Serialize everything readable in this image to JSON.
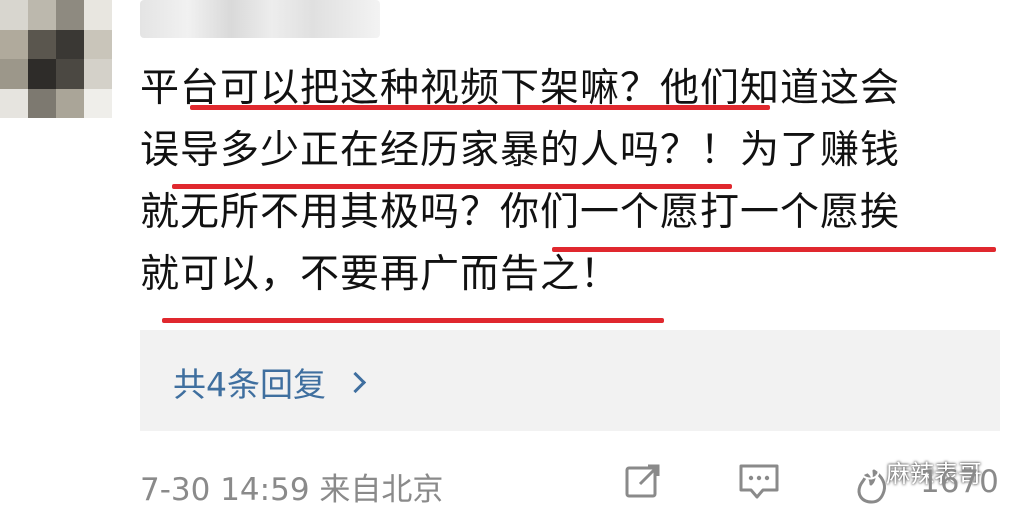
{
  "comment": {
    "lines": [
      "平台可以把这种视频下架嘛？他们知道这会",
      "误导多少正在经历家暴的人吗？！为了赚钱",
      "就无所不用其极吗？你们一个愿打一个愿挨",
      "就可以，不要再广而告之！"
    ]
  },
  "replies": {
    "label": "共4条回复"
  },
  "footer": {
    "meta": "7-30 14:59 来自北京",
    "like_count": "1670"
  },
  "watermark": {
    "text": "麻辣表哥"
  },
  "colors": {
    "underline": "#e0282e",
    "link": "#3f6f9f",
    "meta": "#8a8a8a",
    "reply_bg": "#f2f2f2"
  },
  "icons": [
    "share-icon",
    "comment-icon",
    "like-icon",
    "wechat-icon",
    "chevron-right-icon"
  ]
}
